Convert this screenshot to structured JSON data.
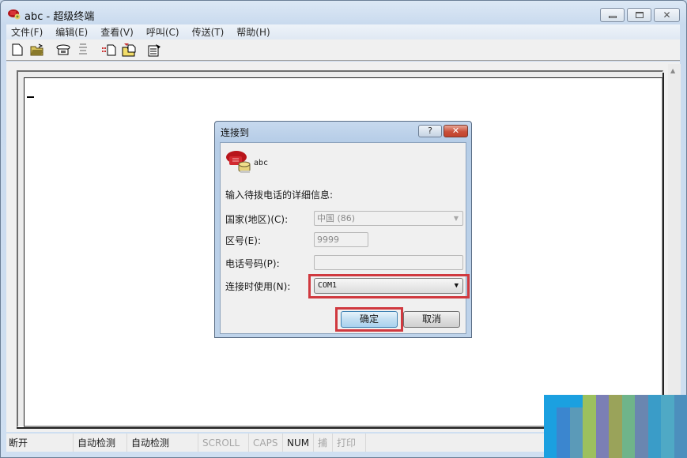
{
  "window": {
    "title": "abc - 超级终端",
    "controls": {
      "minimize": "minimize",
      "maximize": "maximize",
      "close": "close"
    }
  },
  "menubar": {
    "items": [
      "文件(F)",
      "编辑(E)",
      "查看(V)",
      "呼叫(C)",
      "传送(T)",
      "帮助(H)"
    ]
  },
  "toolbar": {
    "icons": [
      "new-document-icon",
      "open-folder-icon",
      "call-icon",
      "disconnect-icon",
      "send-file-icon",
      "receive-file-icon",
      "properties-icon"
    ]
  },
  "terminal": {
    "cursor": "_"
  },
  "statusbar": {
    "connection": "断开",
    "detect1": "自动检测",
    "detect2": "自动检测",
    "scroll": "SCROLL",
    "caps": "CAPS",
    "num": "NUM",
    "capture": "捕",
    "print": "打印"
  },
  "dialog": {
    "title": "连接到",
    "help": "?",
    "connection_name": "abc",
    "prompt": "输入待拨电话的详细信息:",
    "country_label": "国家(地区)(C):",
    "country_value": "中国 (86)",
    "area_label": "区号(E):",
    "area_value": "9999",
    "phone_label": "电话号码(P):",
    "phone_value": "",
    "connect_using_label": "连接时使用(N):",
    "connect_using_value": "COM1",
    "ok": "确定",
    "cancel": "取消",
    "highlight_color": "#d0393f"
  }
}
